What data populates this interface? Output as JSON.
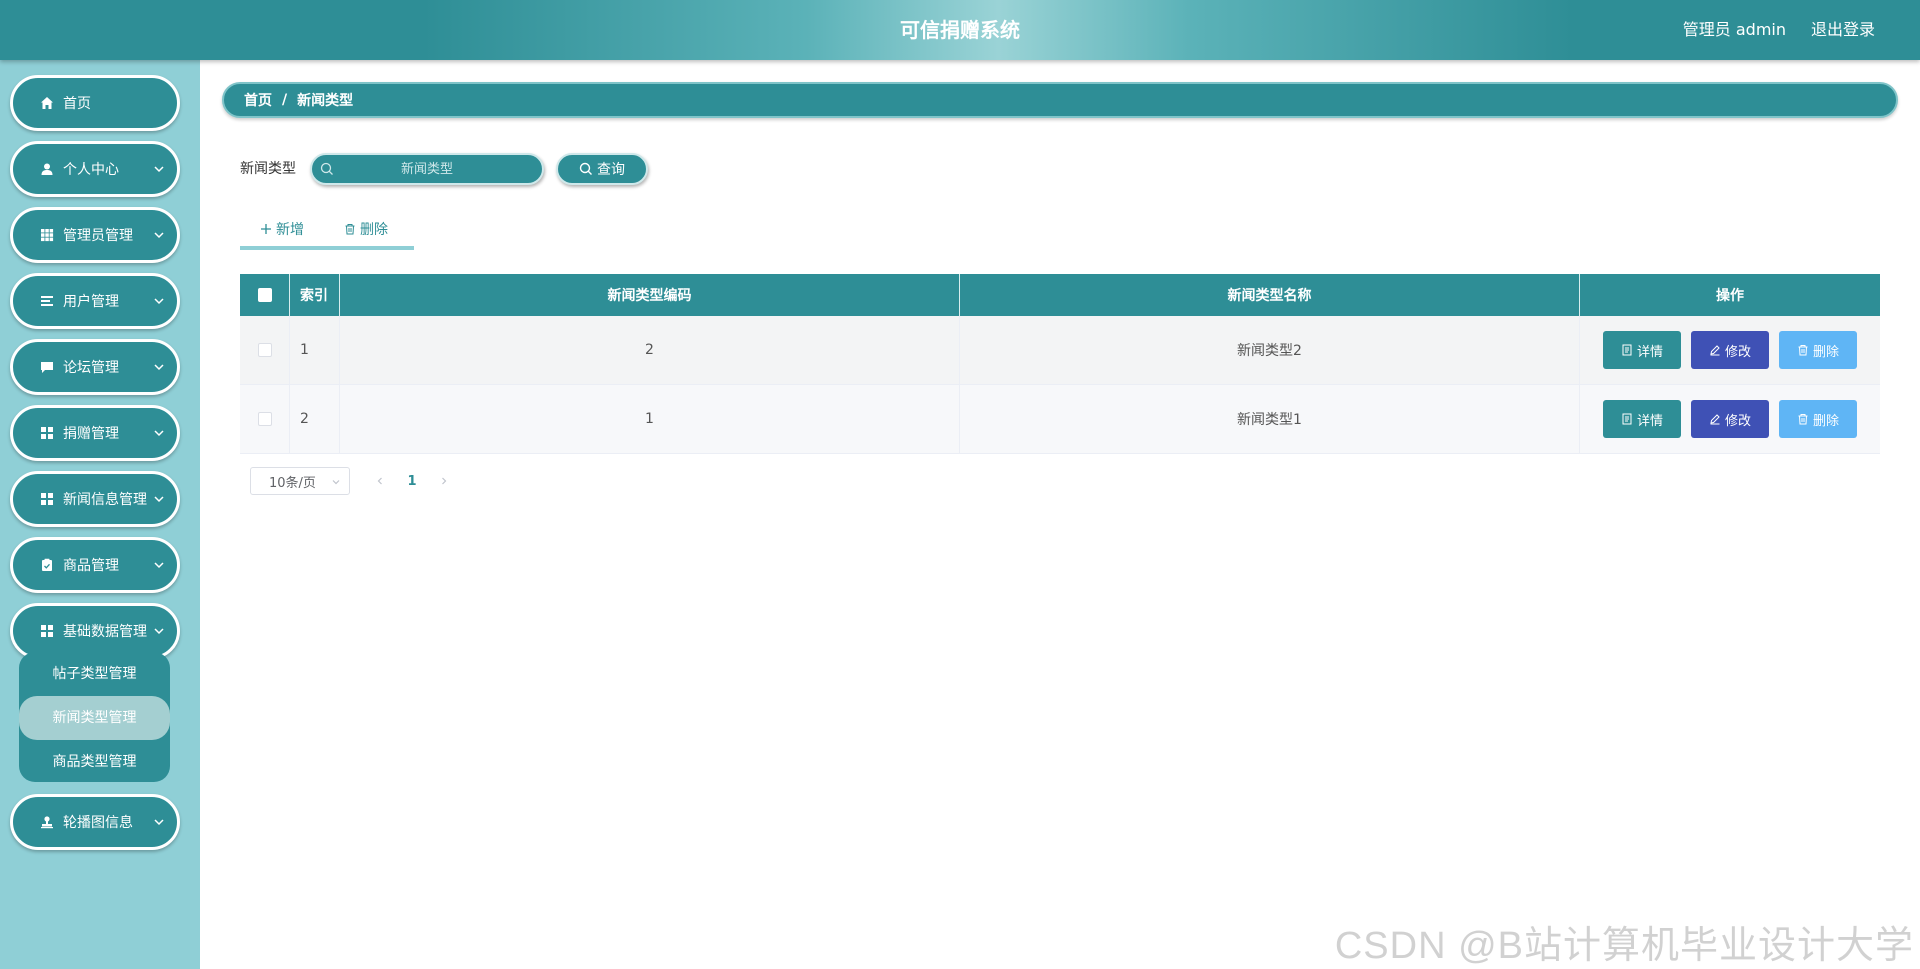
{
  "header": {
    "title": "可信捐赠系统",
    "user": "管理员 admin",
    "logout": "退出登录"
  },
  "sidebar": {
    "items": [
      {
        "label": "首页",
        "icon": "home-icon",
        "has_arrow": false
      },
      {
        "label": "个人中心",
        "icon": "user-icon",
        "has_arrow": true
      },
      {
        "label": "管理员管理",
        "icon": "grid-icon",
        "has_arrow": true
      },
      {
        "label": "用户管理",
        "icon": "list-icon",
        "has_arrow": true
      },
      {
        "label": "论坛管理",
        "icon": "chat-icon",
        "has_arrow": true
      },
      {
        "label": "捐赠管理",
        "icon": "apps-icon",
        "has_arrow": true
      },
      {
        "label": "新闻信息管理",
        "icon": "apps-icon",
        "has_arrow": true
      },
      {
        "label": "商品管理",
        "icon": "clipboard-icon",
        "has_arrow": true
      },
      {
        "label": "基础数据管理",
        "icon": "apps-icon",
        "has_arrow": true
      },
      {
        "label": "轮播图信息",
        "icon": "stamp-icon",
        "has_arrow": true
      }
    ],
    "submenu": [
      {
        "label": "帖子类型管理",
        "active": false
      },
      {
        "label": "新闻类型管理",
        "active": true
      },
      {
        "label": "商品类型管理",
        "active": false
      }
    ]
  },
  "breadcrumb": {
    "home": "首页",
    "separator": "/",
    "current": "新闻类型"
  },
  "search": {
    "label": "新闻类型",
    "placeholder": "新闻类型",
    "button": "查询"
  },
  "toolbar": {
    "add": "新增",
    "delete": "删除"
  },
  "table": {
    "columns": [
      "索引",
      "新闻类型编码",
      "新闻类型名称",
      "操作"
    ],
    "rows": [
      {
        "index": "1",
        "code": "2",
        "name": "新闻类型2"
      },
      {
        "index": "2",
        "code": "1",
        "name": "新闻类型1"
      }
    ],
    "actions": {
      "detail": "详情",
      "edit": "修改",
      "delete": "删除"
    }
  },
  "pagination": {
    "page_size": "10条/页",
    "current_page": "1"
  },
  "watermark": "CSDN @B站计算机毕业设计大学",
  "colors": {
    "primary": "#2e8e96",
    "sidebar_bg": "#8fcfd6",
    "edit": "#3f51b5",
    "delete": "#5fb5f5"
  }
}
